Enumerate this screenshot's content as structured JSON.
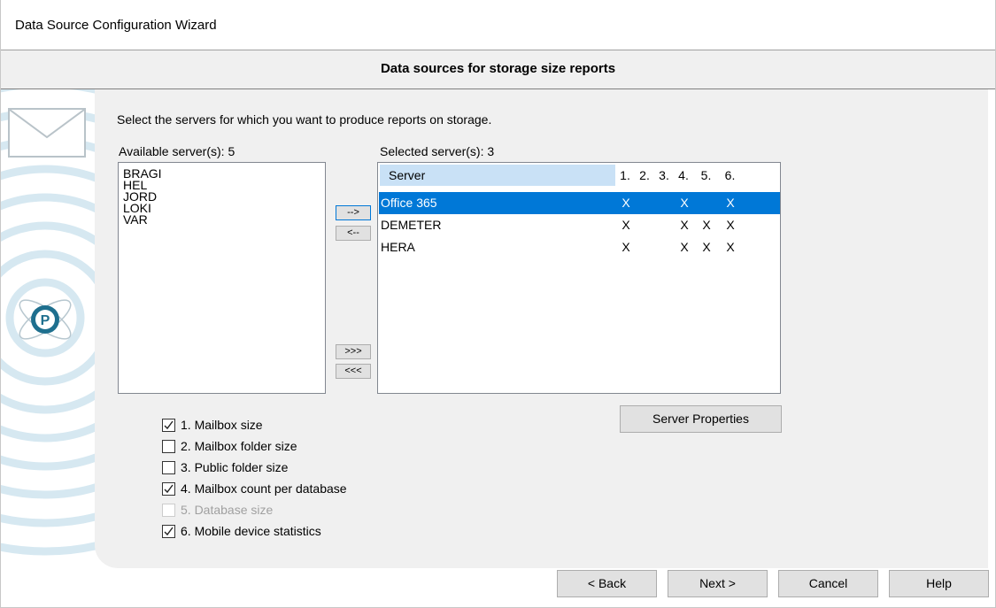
{
  "window": {
    "title": "Data Source Configuration Wizard"
  },
  "header": {
    "title": "Data sources for storage size reports"
  },
  "instruction": "Select the servers for which you want to produce reports on storage.",
  "available": {
    "label": "Available server(s): 5",
    "items": [
      "BRAGI",
      "HEL",
      "JORD",
      "LOKI",
      "VAR"
    ]
  },
  "transfer_buttons": {
    "add": "-->",
    "remove": "<--",
    "add_all": ">>>",
    "remove_all": "<<<"
  },
  "selected": {
    "label": "Selected server(s): 3",
    "columns": [
      "Server",
      "1.",
      "2.",
      "3.",
      "4.",
      "5.",
      "6."
    ],
    "rows": [
      {
        "server": "Office 365",
        "c1": "X",
        "c2": "",
        "c3": "",
        "c4": "X",
        "c5": "",
        "c6": "X",
        "selected": true
      },
      {
        "server": "DEMETER",
        "c1": "X",
        "c2": "",
        "c3": "",
        "c4": "X",
        "c5": "X",
        "c6": "X",
        "selected": false
      },
      {
        "server": "HERA",
        "c1": "X",
        "c2": "",
        "c3": "",
        "c4": "X",
        "c5": "X",
        "c6": "X",
        "selected": false
      }
    ]
  },
  "server_properties_label": "Server Properties",
  "options": [
    {
      "label": "1. Mailbox size",
      "checked": true,
      "enabled": true
    },
    {
      "label": "2. Mailbox folder size",
      "checked": false,
      "enabled": true
    },
    {
      "label": "3. Public folder size",
      "checked": false,
      "enabled": true
    },
    {
      "label": "4. Mailbox count per database",
      "checked": true,
      "enabled": true
    },
    {
      "label": "5. Database size",
      "checked": false,
      "enabled": false
    },
    {
      "label": "6. Mobile device statistics",
      "checked": true,
      "enabled": true
    }
  ],
  "footer": {
    "back": "< Back",
    "next": "Next >",
    "cancel": "Cancel",
    "help": "Help"
  },
  "colors": {
    "accent": "#0078d7",
    "header_highlight": "#c9e1f6",
    "deco": "#cfe4ef"
  }
}
